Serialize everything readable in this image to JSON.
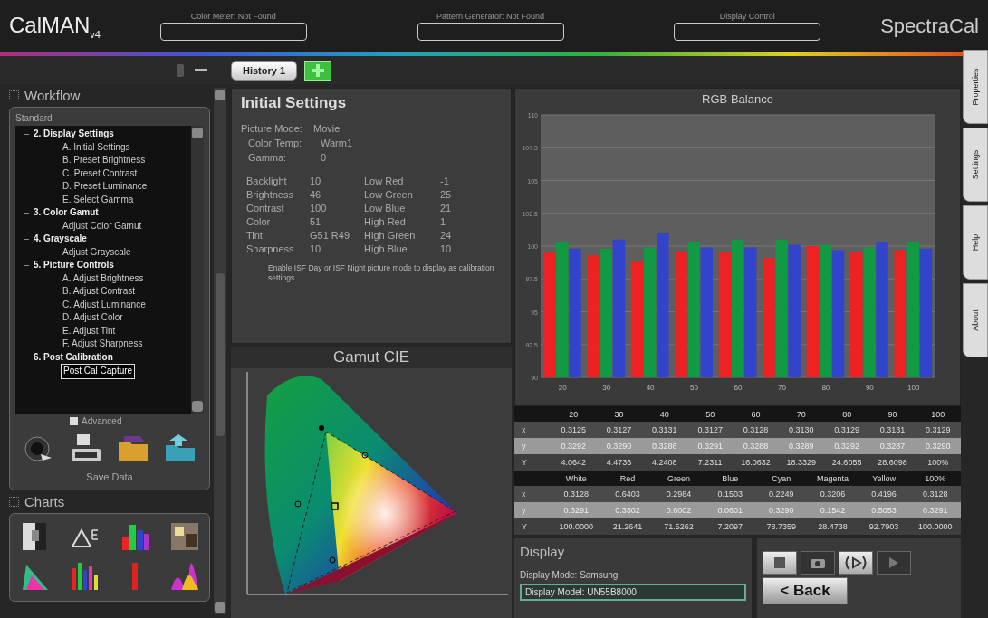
{
  "app": {
    "logo": "CalMAN",
    "version": "v4",
    "brand": "SpectraCal"
  },
  "devices": [
    {
      "label": "Color Meter: Not Found"
    },
    {
      "label": "Pattern Generator: Not Found"
    },
    {
      "label": "Display Control"
    }
  ],
  "history_tabs": [
    {
      "label": "History 1",
      "selected": true
    }
  ],
  "workflow": {
    "title": "Workflow",
    "preset": "Standard",
    "tree": [
      {
        "label": "2. Display Settings",
        "expanded": true,
        "selected": false,
        "children": [
          {
            "label": "A. Initial Settings",
            "selected": false
          },
          {
            "label": "B. Preset Brightness",
            "selected": false
          },
          {
            "label": "C. Preset Contrast",
            "selected": false
          },
          {
            "label": "D. Preset Luminance",
            "selected": false
          },
          {
            "label": "E. Select Gamma",
            "selected": false
          }
        ]
      },
      {
        "label": "3. Color Gamut",
        "expanded": true,
        "selected": false,
        "children": [
          {
            "label": "Adjust Color Gamut",
            "selected": false
          }
        ]
      },
      {
        "label": "4. Grayscale",
        "expanded": true,
        "selected": false,
        "children": [
          {
            "label": "Adjust Grayscale",
            "selected": false
          }
        ]
      },
      {
        "label": "5. Picture Controls",
        "expanded": true,
        "selected": false,
        "children": [
          {
            "label": "A. Adjust Brightness",
            "selected": false
          },
          {
            "label": "B. Adjust Contrast",
            "selected": false
          },
          {
            "label": "C. Adjust Luminance",
            "selected": false
          },
          {
            "label": "D. Adjust Color",
            "selected": false
          },
          {
            "label": "E. Adjust Tint",
            "selected": false
          },
          {
            "label": "F. Adjust Sharpness",
            "selected": false
          }
        ]
      },
      {
        "label": "6. Post Calibration",
        "expanded": true,
        "selected": false,
        "children": [
          {
            "label": "Post Cal Capture",
            "selected": true
          }
        ]
      }
    ],
    "advanced": {
      "label": "Advanced",
      "checked": false
    },
    "save_label": "Save Data"
  },
  "charts_panel": {
    "title": "Charts"
  },
  "initial_settings": {
    "title": "Initial Settings",
    "top": [
      {
        "label": "Picture Mode:",
        "value": "Movie"
      },
      {
        "label": "Color Temp:",
        "value": "Warm1"
      },
      {
        "label": "Gamma:",
        "value": "0"
      }
    ],
    "left": [
      {
        "label": "Backlight",
        "value": "10"
      },
      {
        "label": "Brightness",
        "value": "46"
      },
      {
        "label": "Contrast",
        "value": "100"
      },
      {
        "label": "Color",
        "value": "51"
      },
      {
        "label": "Tint",
        "value": "G51 R49"
      },
      {
        "label": "Sharpness",
        "value": "10"
      }
    ],
    "right": [
      {
        "label": "Low Red",
        "value": "-1"
      },
      {
        "label": "Low Green",
        "value": "25"
      },
      {
        "label": "Low Blue",
        "value": "21"
      },
      {
        "label": "High Red",
        "value": "1"
      },
      {
        "label": "High Green",
        "value": "24"
      },
      {
        "label": "High Blue",
        "value": "10"
      }
    ],
    "note": "Enable ISF Day or ISF Night picture mode to display as calibration settings"
  },
  "gamut": {
    "title": "Gamut CIE"
  },
  "rgb_balance": {
    "title": "RGB Balance",
    "chart_data": {
      "type": "bar",
      "categories": [
        "20",
        "30",
        "40",
        "50",
        "60",
        "70",
        "80",
        "90",
        "100"
      ],
      "grid": true,
      "series": [
        {
          "color": "#ee2222",
          "values": [
            99.5,
            99.3,
            98.8,
            99.6,
            99.5,
            99.1,
            100.0,
            99.5,
            99.7
          ]
        },
        {
          "color": "#119944",
          "values": [
            100.3,
            99.8,
            99.9,
            100.3,
            100.5,
            100.5,
            100.1,
            99.9,
            100.3
          ]
        },
        {
          "color": "#3344cc",
          "values": [
            99.8,
            100.5,
            101.0,
            99.9,
            99.9,
            100.1,
            99.7,
            100.3,
            99.8
          ]
        }
      ],
      "ylim": [
        90,
        110
      ],
      "yticks": [
        90,
        92.5,
        95,
        97.5,
        100,
        102.5,
        105,
        107.5,
        110
      ]
    }
  },
  "tables": [
    {
      "header": [
        "20",
        "30",
        "40",
        "50",
        "60",
        "70",
        "80",
        "90",
        "100"
      ],
      "rows": [
        {
          "label": "x",
          "cells": [
            "0.3125",
            "0.3127",
            "0.3131",
            "0.3127",
            "0.3128",
            "0.3130",
            "0.3129",
            "0.3131",
            "0.3129"
          ]
        },
        {
          "label": "y",
          "cells": [
            "0.3292",
            "0.3290",
            "0.3286",
            "0.3291",
            "0.3288",
            "0.3289",
            "0.3292",
            "0.3287",
            "0.3290"
          ]
        },
        {
          "label": "Y",
          "cells": [
            "4.0642",
            "4.4736",
            "4.2408",
            "7.2311",
            "16.0632",
            "18.3329",
            "24.6055",
            "28.6098",
            "100%"
          ]
        }
      ]
    },
    {
      "header": [
        "White",
        "Red",
        "Green",
        "Blue",
        "Cyan",
        "Magenta",
        "Yellow",
        "100%"
      ],
      "rows": [
        {
          "label": "x",
          "cells": [
            "0.3128",
            "0.6403",
            "0.2984",
            "0.1503",
            "0.2249",
            "0.3206",
            "0.4196",
            "0.3128"
          ]
        },
        {
          "label": "y",
          "cells": [
            "0.3291",
            "0.3302",
            "0.6002",
            "0.0601",
            "0.3290",
            "0.1542",
            "0.5053",
            "0.3291"
          ]
        },
        {
          "label": "Y",
          "cells": [
            "100.0000",
            "21.2641",
            "71.5262",
            "7.2097",
            "78.7359",
            "28.4738",
            "92.7903",
            "100.0000"
          ]
        }
      ]
    }
  ],
  "display": {
    "title": "Display",
    "mode": "Display Mode: Samsung",
    "model": "Display Model: UN55B8000"
  },
  "back_button": "< Back",
  "side_tabs": [
    {
      "label": "Properties"
    },
    {
      "label": "Settings"
    },
    {
      "label": "Help"
    },
    {
      "label": "About"
    }
  ]
}
